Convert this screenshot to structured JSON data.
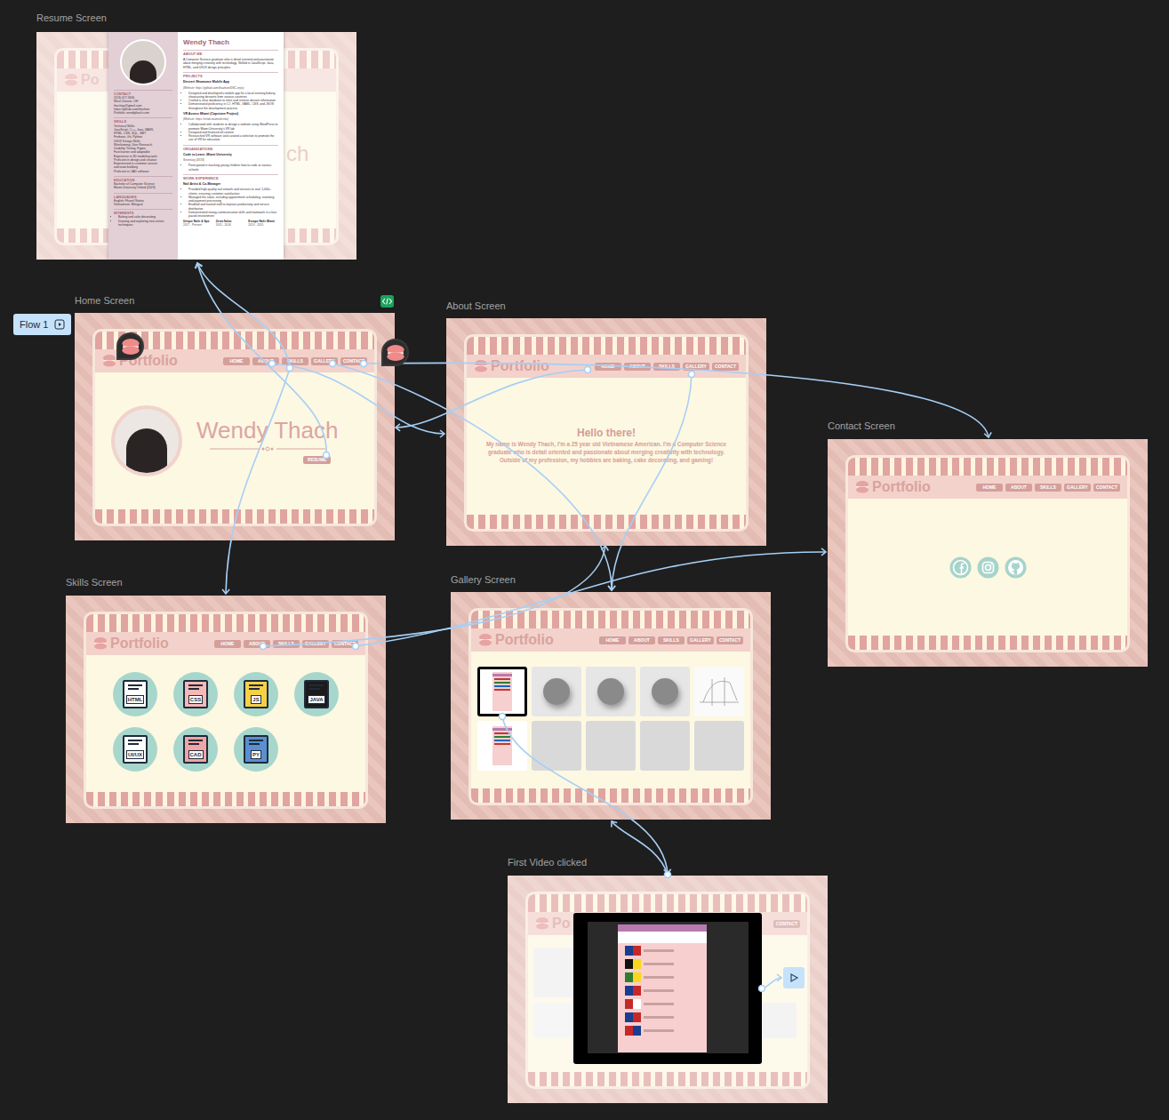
{
  "flow": {
    "label": "Flow 1"
  },
  "brand": "Portfolio",
  "nav": [
    "HOME",
    "ABOUT",
    "SKILLS",
    "GALLERY",
    "CONTACT"
  ],
  "frames": {
    "resume": {
      "title": "Resume Screen",
      "bg_brand": "Po",
      "bg_hero": "ch",
      "doc": {
        "name": "Wendy Thach",
        "sidebar": [
          {
            "heading": "CONTACT",
            "bulleted": false,
            "lines": [
              "(513) 417-5656",
              "West Chester, OH",
              "thachwy@gmail.com",
              "https://github.com/thachwe",
              "Portfolio: wendythach.com"
            ]
          },
          {
            "heading": "SKILLS",
            "bulleted": false,
            "lines": [
              "Technical Skills:",
              "JavaScript, C++, Java, SASS,",
              "HTML, CSS, SQL, .NET",
              "Firebase, Git, Python",
              "UI/UX Design Skills:",
              "Wireframing, User Research,",
              "Usability Testing, Figma",
              "Fast learner and adaptable",
              "Experience in 3D modeling tools",
              "Proficient in design and creative",
              "Experienced in customer service",
              "and team building",
              "Proficient in CAD software"
            ]
          },
          {
            "heading": "EDUCATION",
            "bulleted": false,
            "lines": [
              "Bachelor of Computer Science",
              "Miami University Oxford (2023)"
            ]
          },
          {
            "heading": "LANGUAGES",
            "bulleted": false,
            "lines": [
              "English: Fluent/ Native",
              "Vietnamese: Bilingual"
            ]
          },
          {
            "heading": "INTERESTS",
            "bulleted": true,
            "lines": [
              "Baking and cake decorating",
              "Drawing and exploring new artistic techniques"
            ]
          }
        ],
        "about_heading": "ABOUT ME",
        "about": "A Computer Science graduate who is detail oriented and passionate about merging creativity with technology. Skilled in JavaScript, Java, HTML, and UI/UX design principles.",
        "sections": [
          {
            "heading": "PROJECTS",
            "entries": [
              {
                "title": "Dessert Showcase Mobile App",
                "subtitle": "(Website: https://github.com/thachwe/DSC-repo)",
                "bullets": [
                  "Designed and developed a mobile app for a local evening bakery, showcasing desserts from various countries",
                  "Crafted a clear database to store and retrieve dessert information",
                  "Demonstrated proficiency in C#, HTML, XAML, CSS, and JSON throughout the development process"
                ]
              },
              {
                "title": "VR Across Miami (Capstone Project)",
                "subtitle": "(Website: https://vrlab.miamioh.edu)",
                "bullets": [
                  "Collaborated with students to design a website using WordPress to promote Miami University's VR lab",
                  "Designed and finalized all content",
                  "Researched VR software and curated a selection to promote the use of VR for education"
                ]
              }
            ]
          },
          {
            "heading": "ORGANIZATIONS",
            "entries": [
              {
                "title": "Code to Learn, Miami University",
                "subtitle": "Secretary (2019)",
                "bullets": [
                  "Participated in teaching young children how to code at various schools"
                ]
              }
            ]
          },
          {
            "heading": "WORK EXPERIENCE",
            "entries": [
              {
                "title": "Nail Artist & Co-Manager",
                "bullets": [
                  "Provided high-quality nail artwork and services to over 1,000+ clients, ensuring customer satisfaction",
                  "Managed the salon, including appointment scheduling, inventory, and payment processing",
                  "Enabled and trained staff to improve productivity and service distribution",
                  "Demonstrated strong communication skills and teamwork in a fast-paced environment"
                ]
              }
            ]
          }
        ],
        "jobs": [
          {
            "place": "Unique Nails & Spa",
            "dates": "2017 - Present"
          },
          {
            "place": "Zenia Salon",
            "dates": "2015 - 2016"
          },
          {
            "place": "Escape Nails Miami",
            "dates": "2013 - 2015"
          }
        ]
      }
    },
    "home": {
      "title": "Home Screen",
      "name": "Wendy Thach",
      "button": "RESUME"
    },
    "about": {
      "title": "About Screen",
      "heading": "Hello there!",
      "body": "My name is Wendy Thach, I'm a 25 year old Vietnamese American. I'm a Computer Science graduate who is detail oriented and passionate about merging creativity with technology. Outside of my profession, my hobbies are baking, cake decorating, and gaming!"
    },
    "contact": {
      "title": "Contact Screen"
    },
    "skills": {
      "title": "Skills Screen",
      "items": [
        {
          "label": "HTML",
          "color": "#ffffff"
        },
        {
          "label": "CSS",
          "color": "#f6b7b7"
        },
        {
          "label": "JS",
          "color": "#f7d046"
        },
        {
          "label": "JAVA",
          "color": "#1b1b1b"
        },
        {
          "label": "UI/UX",
          "color": "#ffffff"
        },
        {
          "label": "CAD",
          "color": "#f2a3a3"
        },
        {
          "label": "PY",
          "color": "#5b8fd1"
        }
      ]
    },
    "gallery": {
      "title": "Gallery Screen",
      "items": [
        {
          "kind": "app",
          "selected": true
        },
        {
          "kind": "render",
          "selected": false
        },
        {
          "kind": "render",
          "selected": false
        },
        {
          "kind": "render",
          "selected": false
        },
        {
          "kind": "sketch",
          "selected": false
        },
        {
          "kind": "app",
          "selected": false
        },
        {
          "kind": "empty",
          "selected": false
        },
        {
          "kind": "empty",
          "selected": false
        },
        {
          "kind": "empty",
          "selected": false
        },
        {
          "kind": "empty",
          "selected": false
        }
      ]
    },
    "video": {
      "title": "First Video clicked",
      "bg_brand": "Po",
      "bg_nav": "CONTACT"
    }
  }
}
